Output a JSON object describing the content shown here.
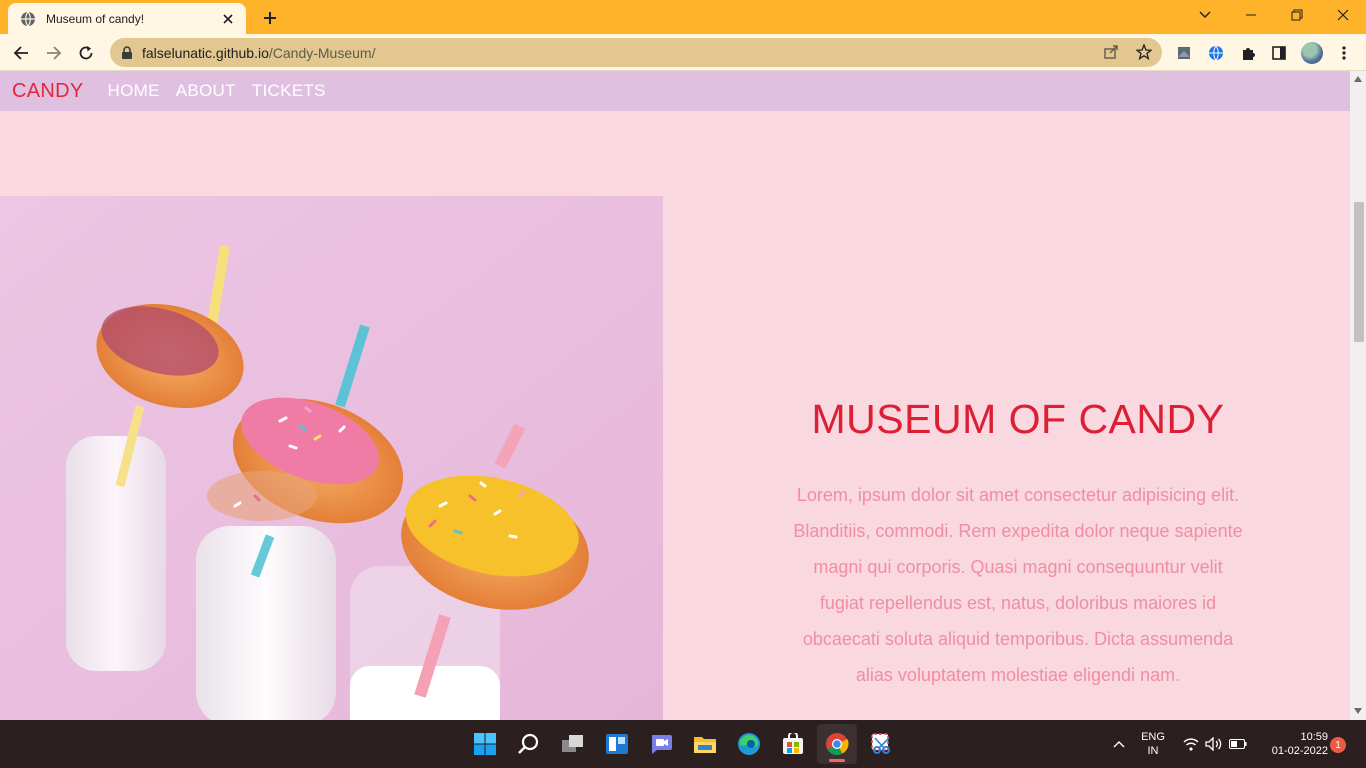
{
  "browser": {
    "tab": {
      "title": "Museum of candy!"
    },
    "address": {
      "domain": "falselunatic.github.io",
      "path": "/Candy-Museum/"
    }
  },
  "site": {
    "logo": "CANDY",
    "nav": [
      "HOME",
      "ABOUT",
      "TICKETS"
    ],
    "hero": {
      "title": "MUSEUM OF CANDY",
      "body": "Lorem, ipsum dolor sit amet consectetur adipisicing elit. Blanditiis, commodi. Rem expedita dolor neque sapiente magni qui corporis. Quasi magni consequuntur velit fugiat repellendus est, natus, doloribus maiores id obcaecati soluta aliquid temporibus. Dicta assumenda alias voluptatem molestiae eligendi nam."
    }
  },
  "taskbar": {
    "lang": "ENG",
    "region": "IN",
    "time": "10:59",
    "date": "01-02-2022",
    "notifications": "1"
  },
  "colors": {
    "tabbar": "#feb32a",
    "site_nav": "#e0c0e1",
    "page_bg": "#f9d8df",
    "accent_red": "#dc1f34",
    "body_pink": "#ef8ea4"
  }
}
